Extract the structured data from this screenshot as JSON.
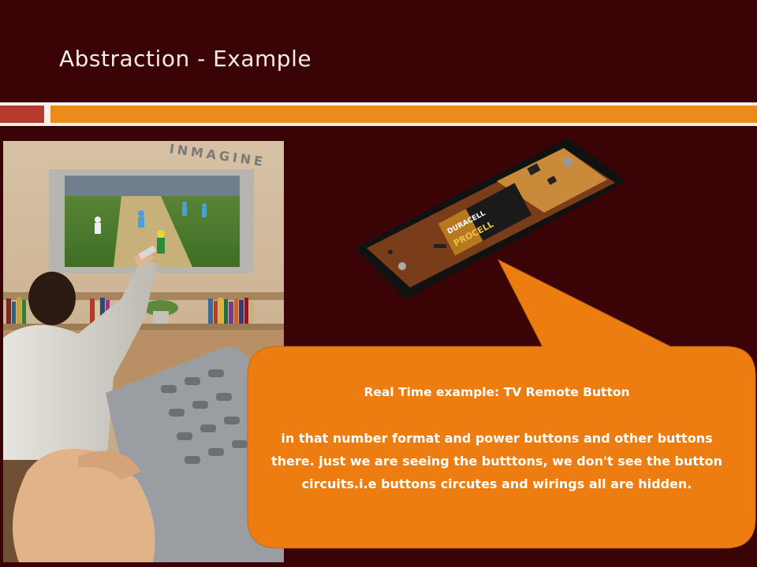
{
  "slide": {
    "title": "Abstraction - Example"
  },
  "photo": {
    "watermark": "INMAGINE"
  },
  "remote": {
    "battery_brand": "DURACELL",
    "battery_line": "PROCELL"
  },
  "bubble": {
    "heading": "Real Time example: TV Remote Button",
    "body": "in that number format and power buttons and other buttons there. just we are seeing the butttons, we don't see the button circuits.i.e buttons circutes and wirings all are hidden."
  },
  "colors": {
    "background": "#3a0406",
    "accent_orange": "#eb8b1a",
    "accent_red": "#b63a2d",
    "bubble_fill": "#ee7d11"
  }
}
